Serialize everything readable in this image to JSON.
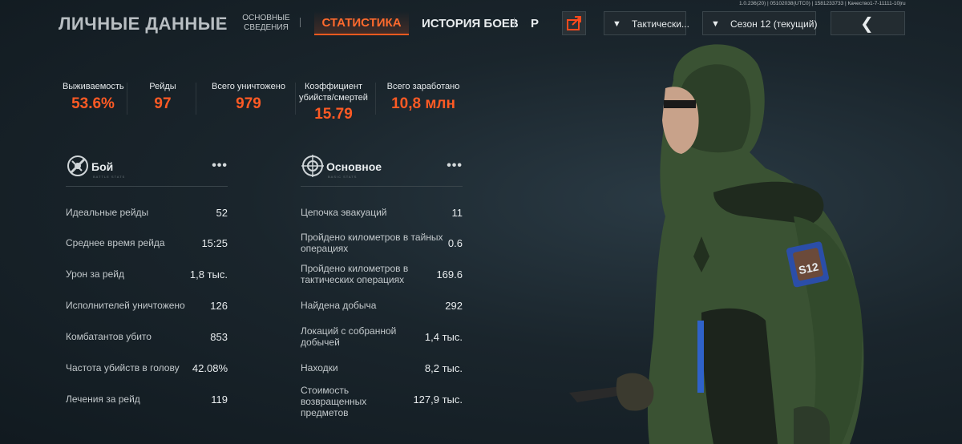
{
  "header": {
    "title": "ЛИЧНЫЕ ДАННЫЕ",
    "tabs": [
      {
        "label": "ОСНОВНЫЕ\nСВЕДЕНИЯ"
      },
      {
        "label": "СТАТИСТИКА"
      },
      {
        "label": "ИСТОРИЯ БОЕВ"
      },
      {
        "label": "Р"
      }
    ],
    "mode_dropdown": "Тактически...",
    "season_dropdown": "Сезон 12 (текущий)",
    "version": "1.0.236(20) | 05102038(UTC0) | 1581233733 | Качество1-7-11111-10|ru",
    "accent": "#ff5a1f"
  },
  "summary": [
    {
      "label": "Выживаемость",
      "value": "53.6%"
    },
    {
      "label": "Рейды",
      "value": "97"
    },
    {
      "label": "Всего уничтожено",
      "value": "979"
    },
    {
      "label": "Коэффициент\nубийств/смертей",
      "value": "15.79"
    },
    {
      "label": "Всего заработано",
      "value": "10,8 млн"
    }
  ],
  "combat": {
    "title": "Бой",
    "subtitle": "BATTLE STATS",
    "rows": [
      {
        "label": "Идеальные рейды",
        "value": "52"
      },
      {
        "label": "Среднее время рейда",
        "value": "15:25"
      },
      {
        "label": "Урон за рейд",
        "value": "1,8 тыс."
      },
      {
        "label": "Исполнителей уничтожено",
        "value": "126"
      },
      {
        "label": "Комбатантов убито",
        "value": "853"
      },
      {
        "label": "Частота убийств в голову",
        "value": "42.08%"
      },
      {
        "label": "Лечения за рейд",
        "value": "119"
      }
    ]
  },
  "basic": {
    "title": "Основное",
    "subtitle": "BASIC STATS",
    "rows": [
      {
        "label": "Цепочка эвакуаций",
        "value": "11"
      },
      {
        "label": "Пройдено километров в тайных\nоперациях",
        "value": "0.6"
      },
      {
        "label": "Пройдено километров в\nтактических операциях",
        "value": "169.6"
      },
      {
        "label": "Найдена добыча",
        "value": "292"
      },
      {
        "label": "Локаций с собранной\nдобычей",
        "value": "1,4 тыс."
      },
      {
        "label": "Находки",
        "value": "8,2 тыс."
      },
      {
        "label": "Стоимость\nвозвращенных\nпредметов",
        "value": "127,9 тыс."
      }
    ]
  },
  "character": {
    "patch_text": "S12"
  }
}
